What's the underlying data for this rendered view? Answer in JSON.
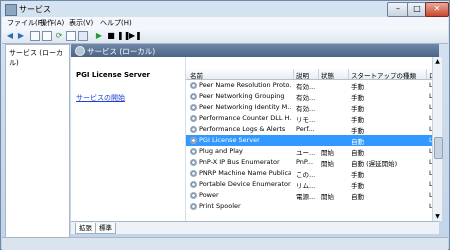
{
  "window": {
    "title": "サービス"
  },
  "menu": [
    "ファイル(F)",
    "操作(A)",
    "表示(V)",
    "ヘルプ(H)"
  ],
  "toolbar": {
    "icons": [
      "back-arrow-icon",
      "forward-arrow-icon",
      "console-tree-icon",
      "properties-icon",
      "refresh-icon",
      "export-icon",
      "help-icon",
      "play-icon",
      "stop-icon",
      "pause-icon",
      "restart-icon"
    ]
  },
  "left_pane": {
    "item": "サービス (ローカル)"
  },
  "main_header": {
    "title": "サービス (ローカル)"
  },
  "detail": {
    "service_name": "PGI License Server",
    "start_link": "サービスの開始"
  },
  "table": {
    "columns": [
      "名前",
      "説明",
      "状態",
      "スタートアップの種類",
      "ロ"
    ],
    "rows": [
      {
        "name": "Peer Name Resolution Proto...",
        "desc": "有効...",
        "status": "",
        "startup": "手動",
        "logon": "Lo",
        "selected": false
      },
      {
        "name": "Peer Networking Grouping",
        "desc": "有効...",
        "status": "",
        "startup": "手動",
        "logon": "Lo",
        "selected": false
      },
      {
        "name": "Peer Networking Identity M...",
        "desc": "有効...",
        "status": "",
        "startup": "手動",
        "logon": "Lo",
        "selected": false
      },
      {
        "name": "Performance Counter DLL H...",
        "desc": "リモ...",
        "status": "",
        "startup": "手動",
        "logon": "Lo",
        "selected": false
      },
      {
        "name": "Performance Logs & Alerts",
        "desc": "Perf...",
        "status": "",
        "startup": "手動",
        "logon": "Lo",
        "selected": false
      },
      {
        "name": "PGI License Server",
        "desc": "",
        "status": "",
        "startup": "自動",
        "logon": "Lo",
        "selected": true
      },
      {
        "name": "Plug and Play",
        "desc": "ユー...",
        "status": "開始",
        "startup": "自動",
        "logon": "Lo",
        "selected": false
      },
      {
        "name": "PnP-X IP Bus Enumerator",
        "desc": "PnP...",
        "status": "開始",
        "startup": "自動 (遅延開始)",
        "logon": "Lo",
        "selected": false
      },
      {
        "name": "PNRP Machine Name Publica...",
        "desc": "この...",
        "status": "",
        "startup": "手動",
        "logon": "Lo",
        "selected": false
      },
      {
        "name": "Portable Device Enumerator...",
        "desc": "リム...",
        "status": "",
        "startup": "手動",
        "logon": "Lo",
        "selected": false
      },
      {
        "name": "Power",
        "desc": "電源...",
        "status": "開始",
        "startup": "自動",
        "logon": "Lo",
        "selected": false
      },
      {
        "name": "Print Spooler",
        "desc": "",
        "status": "",
        "startup": "",
        "logon": "Lo",
        "selected": false
      }
    ]
  },
  "tabs": [
    "拡張",
    "標準"
  ]
}
